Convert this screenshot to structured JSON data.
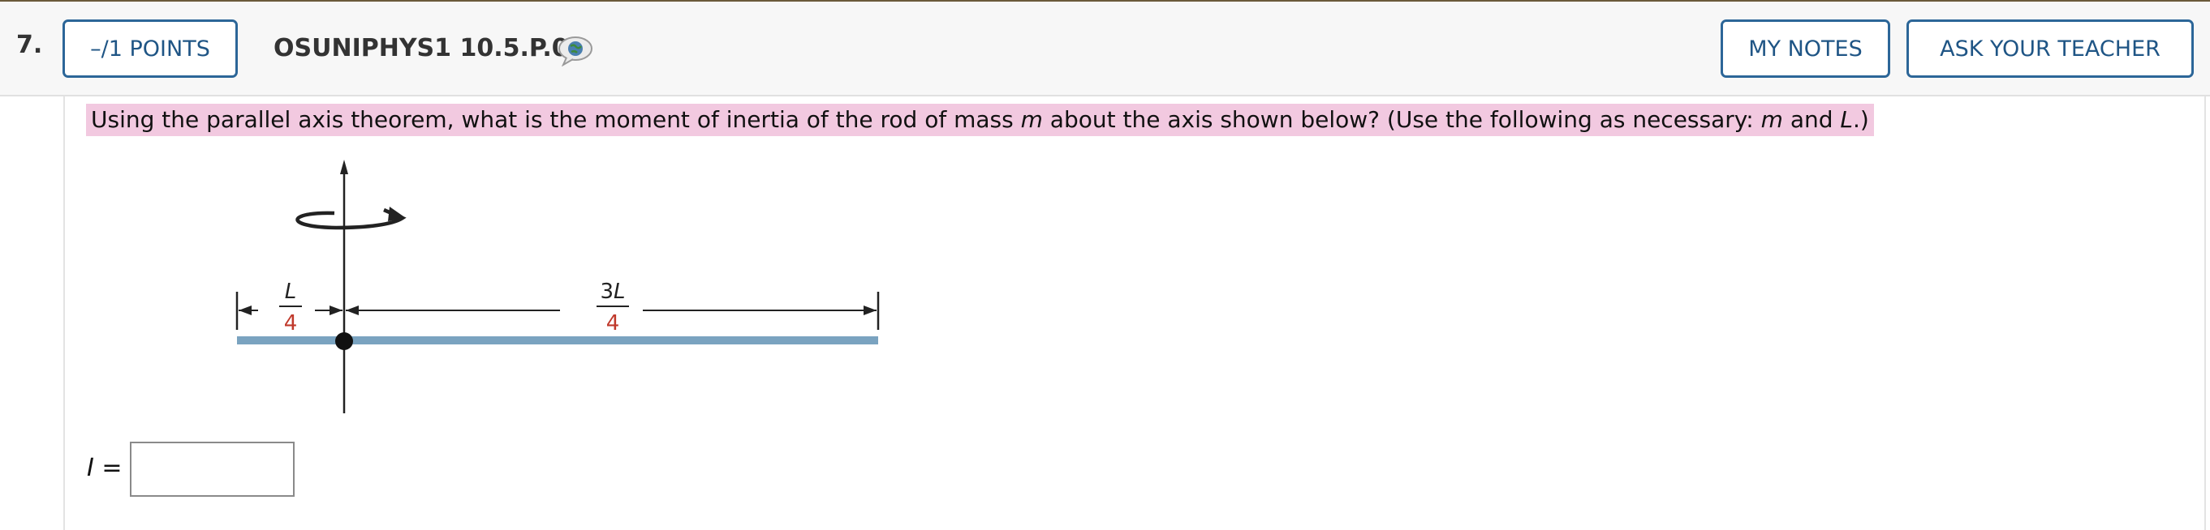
{
  "question": {
    "number": "7.",
    "points_label": "–/1 POINTS",
    "code": "OSUNIPHYS1 10.5.P.06",
    "my_notes_label": "MY NOTES",
    "ask_teacher_label": "ASK YOUR TEACHER",
    "prompt_before_m": "Using the parallel axis theorem, what is the moment of inertia of the rod of mass ",
    "var_m": "m",
    "prompt_after_m": " about the axis shown below? (Use the following as necessary: ",
    "var_m2": "m",
    "prompt_and": " and ",
    "var_L": "L",
    "prompt_end": ".)"
  },
  "figure": {
    "left_num": "L",
    "left_den": "4",
    "right_num": "3L",
    "right_den": "4",
    "rod_color": "#7aa3c0",
    "denominator_color": "#c0392b"
  },
  "answer": {
    "label_var": "I",
    "label_eq": " =",
    "value": ""
  }
}
